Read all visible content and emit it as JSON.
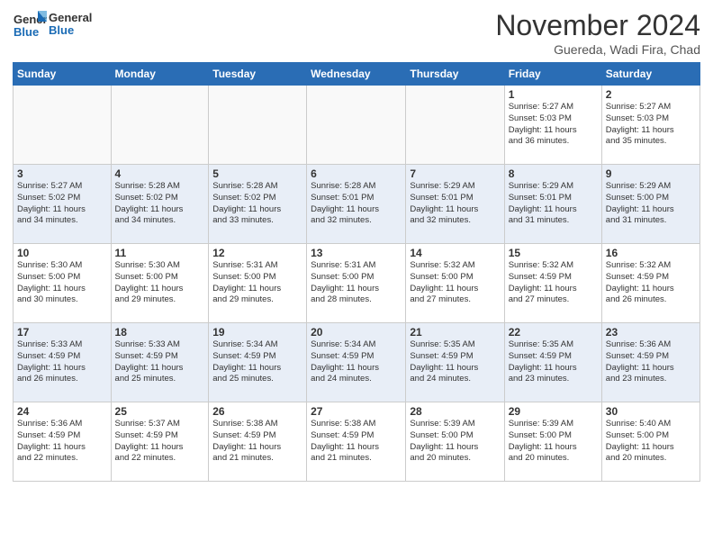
{
  "header": {
    "logo_general": "General",
    "logo_blue": "Blue",
    "month": "November 2024",
    "location": "Guereda, Wadi Fira, Chad"
  },
  "weekdays": [
    "Sunday",
    "Monday",
    "Tuesday",
    "Wednesday",
    "Thursday",
    "Friday",
    "Saturday"
  ],
  "weeks": [
    [
      {
        "day": "",
        "info": ""
      },
      {
        "day": "",
        "info": ""
      },
      {
        "day": "",
        "info": ""
      },
      {
        "day": "",
        "info": ""
      },
      {
        "day": "",
        "info": ""
      },
      {
        "day": "1",
        "info": "Sunrise: 5:27 AM\nSunset: 5:03 PM\nDaylight: 11 hours\nand 36 minutes."
      },
      {
        "day": "2",
        "info": "Sunrise: 5:27 AM\nSunset: 5:03 PM\nDaylight: 11 hours\nand 35 minutes."
      }
    ],
    [
      {
        "day": "3",
        "info": "Sunrise: 5:27 AM\nSunset: 5:02 PM\nDaylight: 11 hours\nand 34 minutes."
      },
      {
        "day": "4",
        "info": "Sunrise: 5:28 AM\nSunset: 5:02 PM\nDaylight: 11 hours\nand 34 minutes."
      },
      {
        "day": "5",
        "info": "Sunrise: 5:28 AM\nSunset: 5:02 PM\nDaylight: 11 hours\nand 33 minutes."
      },
      {
        "day": "6",
        "info": "Sunrise: 5:28 AM\nSunset: 5:01 PM\nDaylight: 11 hours\nand 32 minutes."
      },
      {
        "day": "7",
        "info": "Sunrise: 5:29 AM\nSunset: 5:01 PM\nDaylight: 11 hours\nand 32 minutes."
      },
      {
        "day": "8",
        "info": "Sunrise: 5:29 AM\nSunset: 5:01 PM\nDaylight: 11 hours\nand 31 minutes."
      },
      {
        "day": "9",
        "info": "Sunrise: 5:29 AM\nSunset: 5:00 PM\nDaylight: 11 hours\nand 31 minutes."
      }
    ],
    [
      {
        "day": "10",
        "info": "Sunrise: 5:30 AM\nSunset: 5:00 PM\nDaylight: 11 hours\nand 30 minutes."
      },
      {
        "day": "11",
        "info": "Sunrise: 5:30 AM\nSunset: 5:00 PM\nDaylight: 11 hours\nand 29 minutes."
      },
      {
        "day": "12",
        "info": "Sunrise: 5:31 AM\nSunset: 5:00 PM\nDaylight: 11 hours\nand 29 minutes."
      },
      {
        "day": "13",
        "info": "Sunrise: 5:31 AM\nSunset: 5:00 PM\nDaylight: 11 hours\nand 28 minutes."
      },
      {
        "day": "14",
        "info": "Sunrise: 5:32 AM\nSunset: 5:00 PM\nDaylight: 11 hours\nand 27 minutes."
      },
      {
        "day": "15",
        "info": "Sunrise: 5:32 AM\nSunset: 4:59 PM\nDaylight: 11 hours\nand 27 minutes."
      },
      {
        "day": "16",
        "info": "Sunrise: 5:32 AM\nSunset: 4:59 PM\nDaylight: 11 hours\nand 26 minutes."
      }
    ],
    [
      {
        "day": "17",
        "info": "Sunrise: 5:33 AM\nSunset: 4:59 PM\nDaylight: 11 hours\nand 26 minutes."
      },
      {
        "day": "18",
        "info": "Sunrise: 5:33 AM\nSunset: 4:59 PM\nDaylight: 11 hours\nand 25 minutes."
      },
      {
        "day": "19",
        "info": "Sunrise: 5:34 AM\nSunset: 4:59 PM\nDaylight: 11 hours\nand 25 minutes."
      },
      {
        "day": "20",
        "info": "Sunrise: 5:34 AM\nSunset: 4:59 PM\nDaylight: 11 hours\nand 24 minutes."
      },
      {
        "day": "21",
        "info": "Sunrise: 5:35 AM\nSunset: 4:59 PM\nDaylight: 11 hours\nand 24 minutes."
      },
      {
        "day": "22",
        "info": "Sunrise: 5:35 AM\nSunset: 4:59 PM\nDaylight: 11 hours\nand 23 minutes."
      },
      {
        "day": "23",
        "info": "Sunrise: 5:36 AM\nSunset: 4:59 PM\nDaylight: 11 hours\nand 23 minutes."
      }
    ],
    [
      {
        "day": "24",
        "info": "Sunrise: 5:36 AM\nSunset: 4:59 PM\nDaylight: 11 hours\nand 22 minutes."
      },
      {
        "day": "25",
        "info": "Sunrise: 5:37 AM\nSunset: 4:59 PM\nDaylight: 11 hours\nand 22 minutes."
      },
      {
        "day": "26",
        "info": "Sunrise: 5:38 AM\nSunset: 4:59 PM\nDaylight: 11 hours\nand 21 minutes."
      },
      {
        "day": "27",
        "info": "Sunrise: 5:38 AM\nSunset: 4:59 PM\nDaylight: 11 hours\nand 21 minutes."
      },
      {
        "day": "28",
        "info": "Sunrise: 5:39 AM\nSunset: 5:00 PM\nDaylight: 11 hours\nand 20 minutes."
      },
      {
        "day": "29",
        "info": "Sunrise: 5:39 AM\nSunset: 5:00 PM\nDaylight: 11 hours\nand 20 minutes."
      },
      {
        "day": "30",
        "info": "Sunrise: 5:40 AM\nSunset: 5:00 PM\nDaylight: 11 hours\nand 20 minutes."
      }
    ]
  ]
}
